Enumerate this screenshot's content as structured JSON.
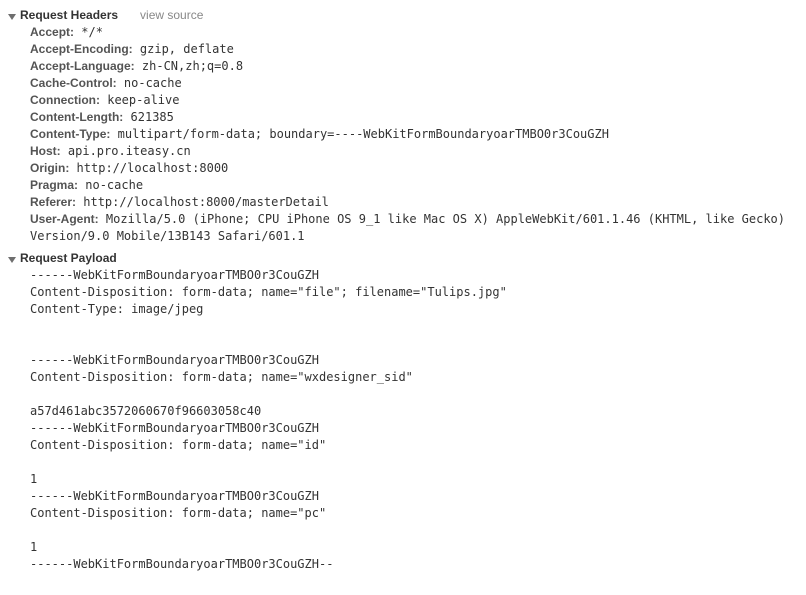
{
  "sections": {
    "requestHeaders": {
      "title": "Request Headers",
      "viewSourceLabel": "view source",
      "headers": [
        {
          "name": "Accept:",
          "value": " */*"
        },
        {
          "name": "Accept-Encoding:",
          "value": " gzip, deflate"
        },
        {
          "name": "Accept-Language:",
          "value": " zh-CN,zh;q=0.8"
        },
        {
          "name": "Cache-Control:",
          "value": " no-cache"
        },
        {
          "name": "Connection:",
          "value": " keep-alive"
        },
        {
          "name": "Content-Length:",
          "value": " 621385"
        },
        {
          "name": "Content-Type:",
          "value": " multipart/form-data; boundary=----WebKitFormBoundaryoarTMBO0r3CouGZH"
        },
        {
          "name": "Host:",
          "value": " api.pro.iteasy.cn"
        },
        {
          "name": "Origin:",
          "value": " http://localhost:8000"
        },
        {
          "name": "Pragma:",
          "value": " no-cache"
        },
        {
          "name": "Referer:",
          "value": " http://localhost:8000/masterDetail"
        },
        {
          "name": "User-Agent:",
          "value": " Mozilla/5.0 (iPhone; CPU iPhone OS 9_1 like Mac OS X) AppleWebKit/601.1.46 (KHTML, like Gecko) Version/9.0 Mobile/13B143 Safari/601.1"
        }
      ]
    },
    "requestPayload": {
      "title": "Request Payload",
      "body": "------WebKitFormBoundaryoarTMBO0r3CouGZH\nContent-Disposition: form-data; name=\"file\"; filename=\"Tulips.jpg\"\nContent-Type: image/jpeg\n\n\n------WebKitFormBoundaryoarTMBO0r3CouGZH\nContent-Disposition: form-data; name=\"wxdesigner_sid\"\n\na57d461abc3572060670f96603058c40\n------WebKitFormBoundaryoarTMBO0r3CouGZH\nContent-Disposition: form-data; name=\"id\"\n\n1\n------WebKitFormBoundaryoarTMBO0r3CouGZH\nContent-Disposition: form-data; name=\"pc\"\n\n1\n------WebKitFormBoundaryoarTMBO0r3CouGZH--"
    }
  }
}
